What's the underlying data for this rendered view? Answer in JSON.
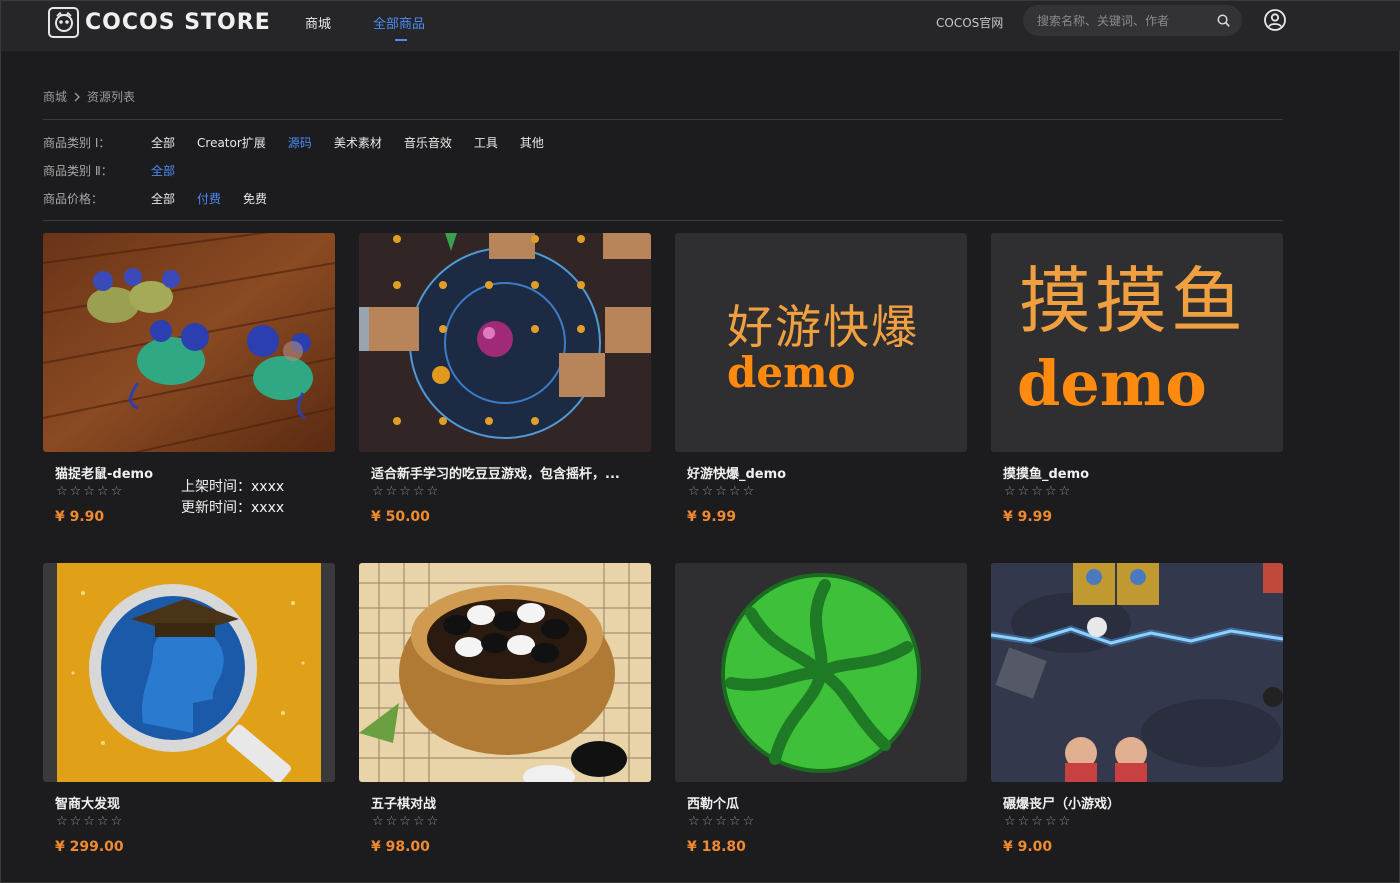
{
  "header": {
    "logo_text": "COCOS STORE",
    "nav": [
      "商城",
      "全部商品"
    ],
    "official_link": "COCOS官网",
    "search_placeholder": "搜索名称、关键词、作者"
  },
  "breadcrumb": [
    "商城",
    "资源列表"
  ],
  "filters": [
    {
      "label": "商品类别 Ⅰ：",
      "options": [
        "全部",
        "Creator扩展",
        "源码",
        "美术素材",
        "音乐音效",
        "工具",
        "其他"
      ],
      "active": 2
    },
    {
      "label": "商品类别 Ⅱ：",
      "options": [
        "全部"
      ],
      "active": 0
    },
    {
      "label": "商品价格：",
      "options": [
        "全部",
        "付费",
        "免费"
      ],
      "active": 1
    }
  ],
  "products": [
    {
      "title": "猫捉老鼠-demo",
      "stars": "☆☆☆☆☆",
      "price": "¥ 9.90"
    },
    {
      "title": "适合新手学习的吃豆豆游戏，包含摇杆，...",
      "stars": "☆☆☆☆☆",
      "price": "¥ 50.00"
    },
    {
      "title": "好游快爆_demo",
      "stars": "☆☆☆☆☆",
      "price": "¥ 9.99",
      "thumb_line1": "好游快爆",
      "thumb_line2": "demo"
    },
    {
      "title": "摸摸鱼_demo",
      "stars": "☆☆☆☆☆",
      "price": "¥ 9.99",
      "thumb_line1": "摸摸鱼",
      "thumb_line2": "demo"
    },
    {
      "title": "智商大发现",
      "stars": "☆☆☆☆☆",
      "price": "¥ 299.00"
    },
    {
      "title": "五子棋对战",
      "stars": "☆☆☆☆☆",
      "price": "¥ 98.00"
    },
    {
      "title": "西勒个瓜",
      "stars": "☆☆☆☆☆",
      "price": "¥ 18.80"
    },
    {
      "title": "碾爆丧尸（小游戏）",
      "stars": "☆☆☆☆☆",
      "price": "¥ 9.00"
    }
  ],
  "tooltip": {
    "listed": "上架时间：xxxx",
    "updated": "更新时间：xxxx"
  },
  "colors": {
    "accent": "#4c8cf5",
    "price": "#f08a30",
    "background": "#1c1c1e"
  }
}
